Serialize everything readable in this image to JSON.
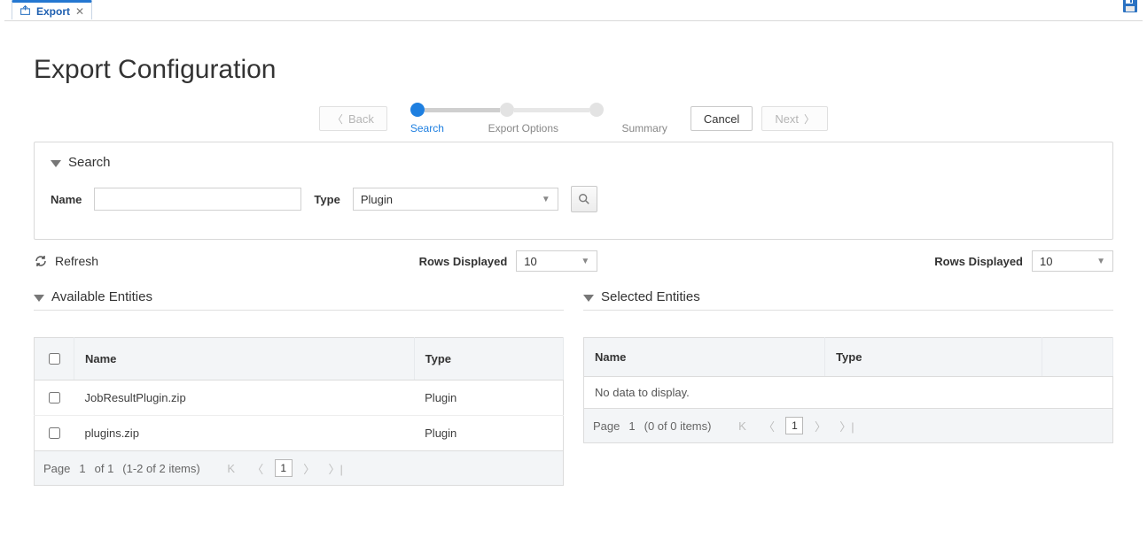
{
  "tab": {
    "title": "Export"
  },
  "page": {
    "title": "Export Configuration"
  },
  "wizard": {
    "back": "Back",
    "cancel": "Cancel",
    "next": "Next",
    "steps": [
      "Search",
      "Export Options",
      "Summary"
    ],
    "active_index": 0
  },
  "search_panel": {
    "title": "Search",
    "name_label": "Name",
    "name_value": "",
    "type_label": "Type",
    "type_value": "Plugin"
  },
  "toolbar": {
    "refresh": "Refresh",
    "rows_displayed_label": "Rows Displayed",
    "rows_displayed_left": "10",
    "rows_displayed_right": "10"
  },
  "available": {
    "title": "Available Entities",
    "columns": {
      "name": "Name",
      "type": "Type"
    },
    "rows": [
      {
        "name": "JobResultPlugin.zip",
        "type": "Plugin"
      },
      {
        "name": "plugins.zip",
        "type": "Plugin"
      }
    ],
    "pager": {
      "page_label": "Page",
      "page": "1",
      "of": "of 1",
      "summary": "(1-2 of 2 items)",
      "current_input": "1"
    }
  },
  "selected": {
    "title": "Selected Entities",
    "columns": {
      "name": "Name",
      "type": "Type"
    },
    "empty": "No data to display.",
    "pager": {
      "page_label": "Page",
      "page": "1",
      "summary": "(0 of 0 items)",
      "current_input": "1"
    }
  }
}
